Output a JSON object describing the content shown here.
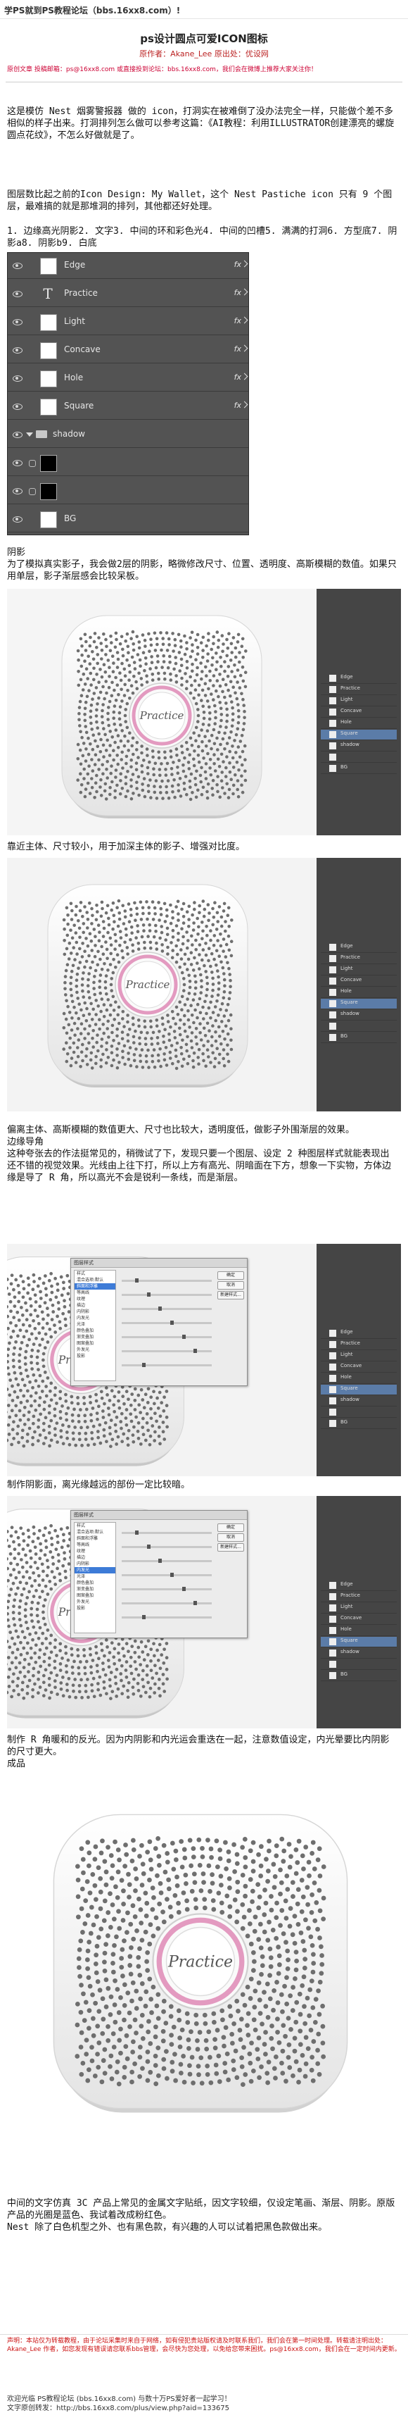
{
  "header": {
    "banner": "学PS就到PS教程论坛（bbs.16xx8.com）!",
    "title": "ps设计圆点可爱ICON图标",
    "author": "原作者：Akane_Lee 原出处：优设网",
    "meta": "原创文章 投稿邮箱：ps@16xx8.com 或直接投到论坛：bbs.16xx8.com，我们会在微博上推荐大家关注你！"
  },
  "intro": {
    "p1": "这是模仿 Nest 烟雾警报器 做的 icon，打洞实在被难倒了没办法完全一样，只能做个差不多相似的样子出来。打洞排列怎么做可以参考这篇：《AI教程：利用ILLUSTRATOR创建漂亮的螺旋圆点花纹》，不怎么好做就是了。",
    "p2": "Nest Pasticche icon 只有 9 个图层，最难搞的就是那堆洞的排列，其他都还好处理。",
    "p3": "图层数比起之前的Icon Design: My Wallet，这个 Nest Pastiche icon 只有 9 个图层，最难搞的就是那堆洞的排列，其他都还好处理。",
    "p4": "1. 边缘高光阴影2. 文字3. 中间的环和彩色光4. 中间的凹槽5. 满满的打洞6. 方型底7. 阴影a8. 阴影b9. 白底"
  },
  "layers_panel": {
    "fx_label": "fx",
    "layers": [
      {
        "name": "Edge",
        "thumb": "white"
      },
      {
        "name": "Practice",
        "thumb": "text",
        "glyph": "T"
      },
      {
        "name": "Light",
        "thumb": "white"
      },
      {
        "name": "Concave",
        "thumb": "white"
      },
      {
        "name": "Hole",
        "thumb": "white"
      },
      {
        "name": "Square",
        "thumb": "white"
      },
      {
        "name": "shadow",
        "thumb": "folder"
      },
      {
        "name": "",
        "thumb": "black"
      },
      {
        "name": "",
        "thumb": "black"
      },
      {
        "name": "BG",
        "thumb": "white"
      }
    ]
  },
  "sections": {
    "s1": "阴影\n为了模拟真实影子，我会做2层的阴影，略微修改尺寸、位置、透明度、高斯模糊的数值。如果只用单层，影子渐层感会比较呆板。",
    "s2": "靠近主体、尺寸较小，用于加深主体的影子、增强对比度。",
    "s3": "偏离主体、高斯模糊的数值更大、尺寸也比较大，透明度低，做影子外围渐层的效果。\n边缘导角\n这种夸张去的作法挺常见的，稍微试了下，发现只要一个图层、设定 2 种图层样式就能表现出还不错的视觉效果。光线由上往下打，所以上方有高光、阴暗面在下方，想象一下实物，方体边缘是导了 R 角，所以高光不会是锐利一条线，而是渐层。",
    "s4": "制作阴影面，离光缘越远的部份一定比较暗。",
    "s5": "制作 R 角暖和的反光。因为内阴影和内光运会重迭在一起，注意数值设定，内光晕要比内阴影的尺寸更大。\n成品",
    "s6": "中间的文字仿真 3C 产品上常见的金属文字贴纸，因文字较细，仅设定笔画、渐层、阴影。原版产品的光圈是蓝色、我试着改成粉红色。\nNest 除了白色机型之外、也有黑色款，有兴趣的人可以试着把黑色款做出来。"
  },
  "badge_text": "Practice",
  "ps_layers_mini": [
    "Edge",
    "Practice",
    "Light",
    "Concave",
    "Hole",
    "Square",
    "shadow",
    "",
    "BG"
  ],
  "dialog": {
    "title": "图层样式",
    "styles": [
      "样式",
      "混合选项:默认",
      "斜面和浮雕",
      "等高线",
      "纹理",
      "描边",
      "内阴影",
      "内发光",
      "光泽",
      "颜色叠加",
      "渐变叠加",
      "图案叠加",
      "外发光",
      "投影"
    ],
    "ok": "确定",
    "cancel": "取消",
    "new": "新建样式..."
  },
  "footer": {
    "red": "声明：本站仅为转载教程，由于论坛采集时来自于网络，如有侵犯贵站版权请及时联系我们，我们会在第一时间处理。转载请注明出处：Akane_Lee 作者，如您发现有错误请您联系bbs管理，会尽快为您处理，以免给您带来困扰。ps@16xx8.com，我们会在一定时间内更新。",
    "blue": "欢迎光临 PS教程论坛 (bbs.16xx8.com) 与数十万PS爱好者一起学习！\n文字原创转发：http://bbs.16xx8.com/plus/view.php?aid=133675"
  },
  "colors": {
    "accent_red": "#cc1111",
    "ps_panel": "#535353",
    "badge_ring": "#e39ac0"
  }
}
